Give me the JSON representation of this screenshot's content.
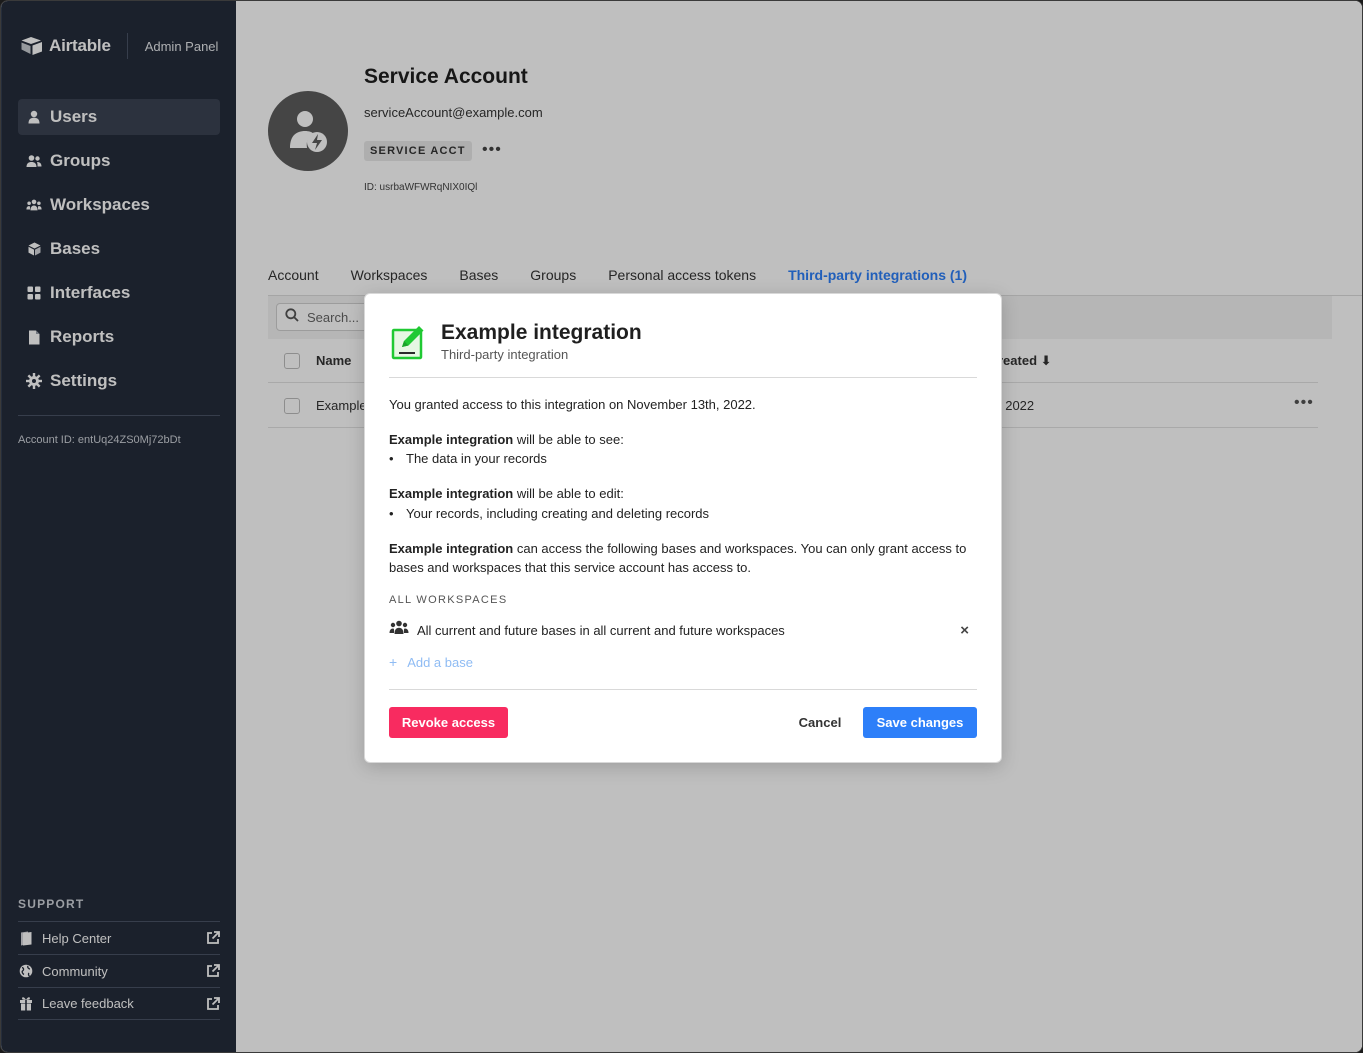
{
  "sidebar": {
    "brand": "Airtable",
    "panel": "Admin Panel",
    "items": [
      {
        "label": "Users",
        "icon": "user-icon",
        "active": true
      },
      {
        "label": "Groups",
        "icon": "group-icon"
      },
      {
        "label": "Workspaces",
        "icon": "workspaces-icon"
      },
      {
        "label": "Bases",
        "icon": "base-cube-icon"
      },
      {
        "label": "Interfaces",
        "icon": "grid-icon"
      },
      {
        "label": "Reports",
        "icon": "document-icon"
      },
      {
        "label": "Settings",
        "icon": "gear-icon"
      }
    ],
    "account_id": "Account ID: entUq24ZS0Mj72bDt",
    "support_title": "SUPPORT",
    "support_items": [
      {
        "label": "Help Center",
        "icon": "book-icon"
      },
      {
        "label": "Community",
        "icon": "globe-icon"
      },
      {
        "label": "Leave feedback",
        "icon": "gift-icon"
      }
    ]
  },
  "profile": {
    "name": "Service Account",
    "email": "serviceAccount@example.com",
    "badge": "SERVICE ACCT",
    "more": "•••",
    "id": "ID: usrbaWFWRqNIX0IQl"
  },
  "tabs": [
    "Account",
    "Workspaces",
    "Bases",
    "Groups",
    "Personal access tokens",
    "Third-party integrations (1)"
  ],
  "active_tab": 5,
  "table": {
    "search_placeholder": "Search...",
    "columns": {
      "name": "Name",
      "created": "reated ⬇"
    },
    "rows": [
      {
        "name": "Example",
        "created": ", 2022",
        "menu": "•••"
      }
    ]
  },
  "modal": {
    "title": "Example integration",
    "subtitle": "Third-party integration",
    "granted": "You granted access to this integration on November 13th, 2022.",
    "integration_name": "Example integration",
    "see_text": " will be able to see:",
    "see_item": "The data in your records",
    "edit_text": " will be able to edit:",
    "edit_item": "Your records, including creating and deleting records",
    "access_text": " can access the following bases and workspaces. You can only grant access to bases and workspaces that this service account has access to.",
    "section_label": "ALL WORKSPACES",
    "workspace_scope": "All current and future bases in all current and future workspaces",
    "remove": "×",
    "add_base": "Add a base",
    "revoke": "Revoke access",
    "cancel": "Cancel",
    "save": "Save changes"
  },
  "colors": {
    "sidebar_bg": "#252d3b",
    "accent_blue": "#2d7ff9",
    "revoke_red": "#f82b60",
    "icon_green": "#20c933"
  }
}
